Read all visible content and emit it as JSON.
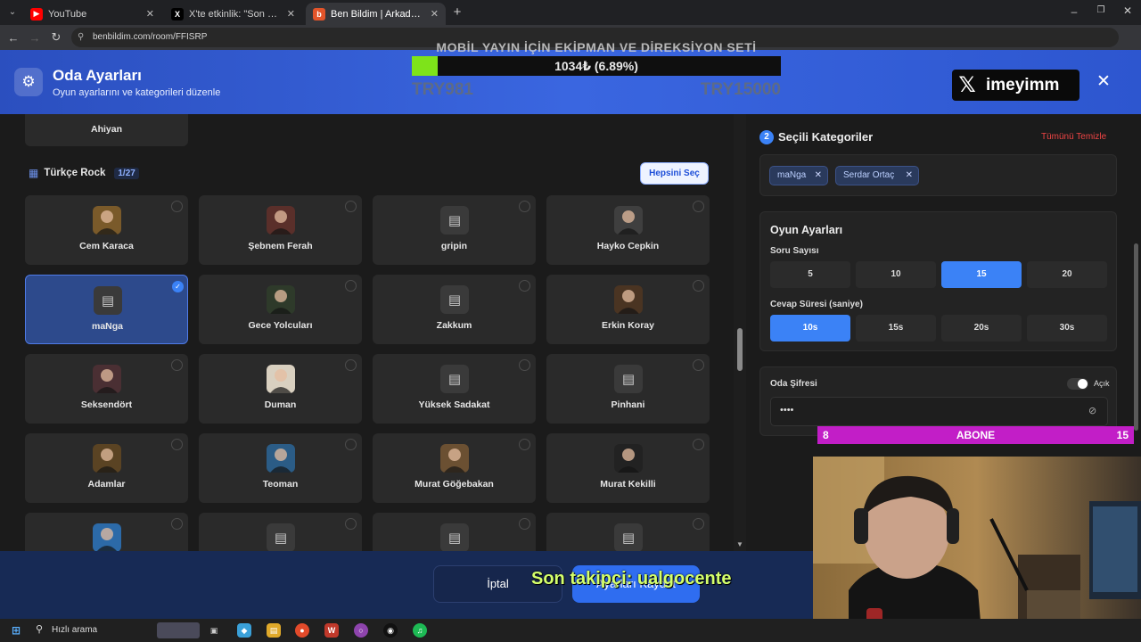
{
  "browser": {
    "tabs": [
      {
        "title": "YouTube",
        "icon": "youtube-icon",
        "active": false
      },
      {
        "title": "X'te etkinlik: \"Son yılların en he...",
        "icon": "x-icon",
        "active": false
      },
      {
        "title": "Ben Bildim | Arkadaşlarınla Onl...",
        "icon": "benbildim-icon",
        "active": true
      }
    ],
    "url": "benbildim.com/room/FFISRP"
  },
  "modal": {
    "title": "Oda Ayarları",
    "subtitle": "Oyun ayarlarını ve kategorileri düzenle"
  },
  "donation": {
    "title": "MOBİL YAYIN İÇİN EKİPMAN VE DİREKSİYON SETİ",
    "progress_text": "1034₺ (6.89%)",
    "progress_fraction": 0.0689,
    "min": "TRY981",
    "max": "TRY15000"
  },
  "x_badge": {
    "name": "imeyimm"
  },
  "left": {
    "top_card": "Ahiyan",
    "section_title": "Türkçe Rock",
    "section_count": "1/27",
    "select_all": "Hepsini Seç",
    "artists": [
      {
        "name": "Cem Karaca",
        "avatar": "photo",
        "color": "#7a5a2a",
        "selected": false
      },
      {
        "name": "Şebnem Ferah",
        "avatar": "photo",
        "color": "#5a2f2a",
        "selected": false
      },
      {
        "name": "gripin",
        "avatar": "placeholder",
        "selected": false
      },
      {
        "name": "Hayko Cepkin",
        "avatar": "photo",
        "color": "#3f3f3f",
        "selected": false
      },
      {
        "name": "maNga",
        "avatar": "placeholder",
        "selected": true
      },
      {
        "name": "Gece Yolcuları",
        "avatar": "photo",
        "color": "#2e3a2a",
        "selected": false
      },
      {
        "name": "Zakkum",
        "avatar": "placeholder",
        "selected": false
      },
      {
        "name": "Erkin Koray",
        "avatar": "photo",
        "color": "#4a3422",
        "selected": false
      },
      {
        "name": "Seksendört",
        "avatar": "photo",
        "color": "#4a2f33",
        "selected": false
      },
      {
        "name": "Duman",
        "avatar": "photo",
        "color": "#d9d0c0",
        "selected": false
      },
      {
        "name": "Yüksek Sadakat",
        "avatar": "placeholder",
        "selected": false
      },
      {
        "name": "Pinhani",
        "avatar": "placeholder",
        "selected": false
      },
      {
        "name": "Adamlar",
        "avatar": "photo",
        "color": "#5a4323",
        "selected": false
      },
      {
        "name": "Teoman",
        "avatar": "photo",
        "color": "#2b5c86",
        "selected": false
      },
      {
        "name": "Murat Göğebakan",
        "avatar": "photo",
        "color": "#6b5032",
        "selected": false
      },
      {
        "name": "Murat Kekilli",
        "avatar": "photo",
        "color": "#222222",
        "selected": false
      },
      {
        "name": "",
        "avatar": "photo",
        "color": "#2c6aa8",
        "selected": false
      },
      {
        "name": "",
        "avatar": "placeholder",
        "selected": false
      },
      {
        "name": "",
        "avatar": "placeholder",
        "selected": false
      },
      {
        "name": "",
        "avatar": "placeholder",
        "selected": false
      }
    ]
  },
  "right": {
    "selected_section": {
      "step": "2",
      "title": "Seçili Kategoriler",
      "clear_all": "Tümünü Temizle",
      "chips": [
        "maNga",
        "Serdar Ortaç"
      ]
    },
    "game_settings": {
      "title": "Oyun Ayarları",
      "question_count_label": "Soru Sayısı",
      "question_counts": [
        "5",
        "10",
        "15",
        "20"
      ],
      "question_count_selected": 2,
      "answer_time_label": "Cevap Süresi (saniye)",
      "answer_times": [
        "10s",
        "15s",
        "20s",
        "30s"
      ],
      "answer_time_selected": 0
    },
    "password": {
      "label": "Oda Şifresi",
      "toggle_label": "Açık",
      "value": "••••"
    }
  },
  "footer": {
    "cancel": "İptal",
    "save": "Ayarları Kaydet",
    "follower_overlay": "Son takipçi: ualgocente"
  },
  "subscriber_bar": {
    "left": "8",
    "label": "ABONE",
    "right": "15"
  },
  "taskbar": {
    "search": "Hızlı arama"
  },
  "colors": {
    "accent": "#3b82f6",
    "header": "#3a66e0",
    "danger": "#ef4444",
    "subscriber": "#c21ec7",
    "progress": "#7ee31a"
  }
}
